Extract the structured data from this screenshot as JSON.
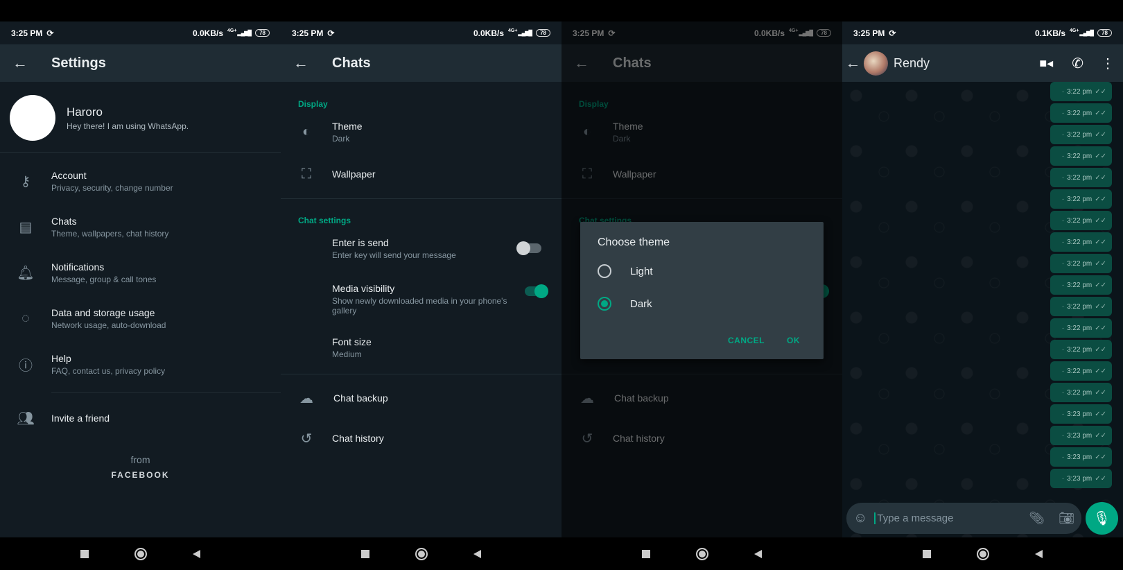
{
  "accent": "#00a884",
  "status_bars": [
    {
      "time": "3:25 PM",
      "speed": "0.0KB/s",
      "network": "4G+",
      "battery": "78"
    },
    {
      "time": "3:25 PM",
      "speed": "0.0KB/s",
      "network": "4G+",
      "battery": "78"
    },
    {
      "time": "3:25 PM",
      "speed": "0.0KB/s",
      "network": "4G+",
      "battery": "78"
    },
    {
      "time": "3:25 PM",
      "speed": "0.1KB/s",
      "network": "4G+",
      "battery": "78"
    }
  ],
  "settings": {
    "title": "Settings",
    "profile": {
      "name": "Haroro",
      "status": "Hey there! I am using WhatsApp."
    },
    "items": [
      {
        "icon": "key-icon",
        "title": "Account",
        "subtitle": "Privacy, security, change number"
      },
      {
        "icon": "chat-icon",
        "title": "Chats",
        "subtitle": "Theme, wallpapers, chat history"
      },
      {
        "icon": "bell-icon",
        "title": "Notifications",
        "subtitle": "Message, group & call tones"
      },
      {
        "icon": "data-usage-icon",
        "title": "Data and storage usage",
        "subtitle": "Network usage, auto-download"
      },
      {
        "icon": "help-icon",
        "title": "Help",
        "subtitle": "FAQ, contact us, privacy policy"
      }
    ],
    "invite": "Invite a friend",
    "from": "from",
    "brand": "FACEBOOK"
  },
  "chats": {
    "title": "Chats",
    "display_section": "Display",
    "theme": {
      "title": "Theme",
      "value": "Dark"
    },
    "wallpaper": "Wallpaper",
    "chat_settings_section": "Chat settings",
    "enter_is_send": {
      "title": "Enter is send",
      "subtitle": "Enter key will send your message",
      "on": false
    },
    "media_visibility": {
      "title": "Media visibility",
      "subtitle": "Show newly downloaded media in your phone's gallery",
      "on": true
    },
    "font_size": {
      "title": "Font size",
      "value": "Medium"
    },
    "backup": "Chat backup",
    "history": "Chat history"
  },
  "dialog": {
    "title": "Choose theme",
    "options": [
      "Light",
      "Dark"
    ],
    "selected": "Dark",
    "cancel": "CANCEL",
    "ok": "OK"
  },
  "conversation": {
    "contact": "Rendy",
    "messages": [
      "3:22 pm",
      "3:22 pm",
      "3:22 pm",
      "3:22 pm",
      "3:22 pm",
      "3:22 pm",
      "3:22 pm",
      "3:22 pm",
      "3:22 pm",
      "3:22 pm",
      "3:22 pm",
      "3:22 pm",
      "3:22 pm",
      "3:22 pm",
      "3:22 pm",
      "3:23 pm",
      "3:23 pm",
      "3:23 pm",
      "3:23 pm"
    ],
    "input_placeholder": "Type a message"
  }
}
